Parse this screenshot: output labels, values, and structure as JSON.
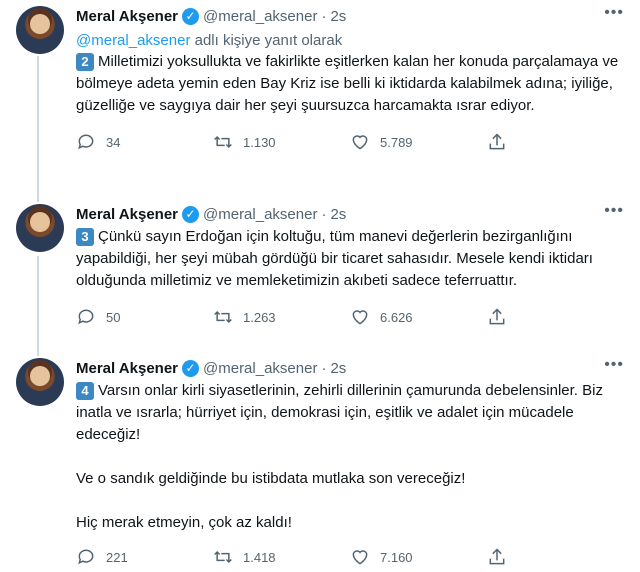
{
  "tweets": [
    {
      "name": "Meral Akşener",
      "handle": "@meral_aksener",
      "time": "2s",
      "reply_mention": "@meral_aksener",
      "reply_text": " adlı kişiye yanıt olarak",
      "badge": "2",
      "text": "Milletimizi yoksullukta ve fakirlikte eşitlerken kalan her konuda parçalamaya ve bölmeye adeta yemin eden Bay Kriz ise belli ki iktidarda kalabilmek adına; iyiliğe, güzelliğe ve saygıya dair her şeyi şuursuzca harcamakta ısrar ediyor.",
      "replies": "34",
      "retweets": "1.130",
      "likes": "5.789"
    },
    {
      "name": "Meral Akşener",
      "handle": "@meral_aksener",
      "time": "2s",
      "badge": "3",
      "text": "Çünkü sayın Erdoğan için koltuğu, tüm manevi değerlerin bezirganlığını yapabildiği, her şeyi mübah gördüğü bir ticaret sahasıdır. Mesele kendi iktidarı olduğunda milletimiz ve memleketimizin akıbeti sadece teferruattır.",
      "replies": "50",
      "retweets": "1.263",
      "likes": "6.626"
    },
    {
      "name": "Meral Akşener",
      "handle": "@meral_aksener",
      "time": "2s",
      "badge": "4",
      "text": "Varsın onlar kirli siyasetlerinin, zehirli dillerinin çamurunda debelensinler. Biz inatla ve ısrarla; hürriyet için, demokrasi için, eşitlik ve adalet için mücadele edeceğiz!\n\nVe o sandık geldiğinde bu istibdata mutlaka son vereceğiz!\n\nHiç merak etmeyin, çok az kaldı!",
      "replies": "221",
      "retweets": "1.418",
      "likes": "7.160"
    }
  ],
  "icons": {
    "verified": "verified-badge-icon",
    "more": "more-options-icon",
    "reply": "reply-icon",
    "retweet": "retweet-icon",
    "like": "heart-icon",
    "share": "share-icon"
  },
  "colors": {
    "accent": "#1d9bf0",
    "secondary_text": "#536471",
    "keycap": "#3b88c3"
  }
}
